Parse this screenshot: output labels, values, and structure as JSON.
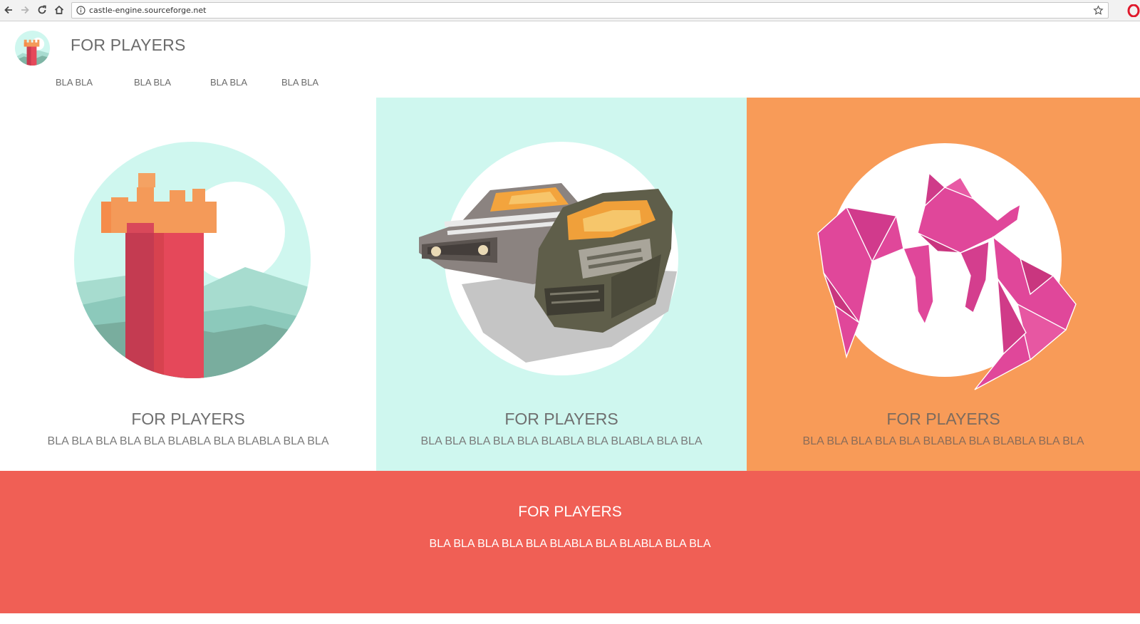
{
  "browser": {
    "url": "castle-engine.sourceforge.net",
    "icons": {
      "back": "back-arrow-icon",
      "forward": "forward-arrow-icon",
      "reload": "reload-icon",
      "home": "home-icon",
      "info": "info-icon",
      "bookmark": "star-icon",
      "browser": "opera-icon"
    }
  },
  "header": {
    "title": "FOR PLAYERS",
    "logo": "castle-tower-logo",
    "nav": [
      {
        "label": "BLA BLA"
      },
      {
        "label": "BLA BLA"
      },
      {
        "label": "BLA BLA"
      },
      {
        "label": "BLA BLA"
      }
    ]
  },
  "panels": [
    {
      "art": "castle-tower-illustration",
      "title": "FOR PLAYERS",
      "text": "BLA BLA BLA BLA BLA BLABLA BLA BLABLA BLA BLA",
      "background": "#ffffff"
    },
    {
      "art": "wrecked-cars-illustration",
      "title": "FOR PLAYERS",
      "text": "BLA BLA BLA BLA BLA BLABLA BLA BLABLA BLA BLA",
      "background": "#cff7ef"
    },
    {
      "art": "pink-origami-creature-illustration",
      "title": "FOR PLAYERS",
      "text": "BLA BLA BLA BLA BLA BLABLA BLA BLABLA BLA BLA",
      "background": "#f89b58"
    }
  ],
  "footer": {
    "title": "FOR PLAYERS",
    "text": "BLA BLA BLA BLA BLA BLABLA BLA BLABLA BLA BLA",
    "background": "#f05f55"
  }
}
